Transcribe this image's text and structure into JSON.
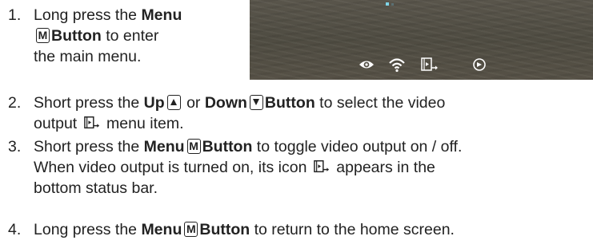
{
  "colors": {
    "text": "#222222",
    "screen_bg": "#534f45",
    "status_icons": "#ffffff"
  },
  "steps": [
    {
      "number": "1.",
      "parts": {
        "a": "Long press the ",
        "b": "Menu",
        "c": "Button",
        "d": " to enter",
        "e": "the main menu."
      }
    },
    {
      "number": "2.",
      "parts": {
        "a": "Short press the ",
        "b": "Up",
        "c": " or ",
        "d": "Down",
        "e": "Button",
        "f": " to select the video",
        "g": "output ",
        "h": " menu item."
      }
    },
    {
      "number": "3.",
      "parts": {
        "a": "Short press the ",
        "b": "Menu",
        "c": "Button",
        "d": " to toggle video output on / off.",
        "e": "When video output is turned on, its icon ",
        "f": " appears in the",
        "g": "bottom status bar."
      }
    },
    {
      "number": "4.",
      "parts": {
        "a": "Long press the ",
        "b": "Menu",
        "c": "Button",
        "d": " to return to the home screen."
      }
    }
  ],
  "key_glyphs": {
    "menu": "M"
  },
  "icons": {
    "menu_key": "menu-key-icon",
    "up_key": "up-key-icon",
    "down_key": "down-key-icon",
    "video_output": "video-output-icon",
    "status_bar": [
      "eye-icon",
      "wifi-icon",
      "video-output-icon",
      "gps-icon"
    ]
  }
}
